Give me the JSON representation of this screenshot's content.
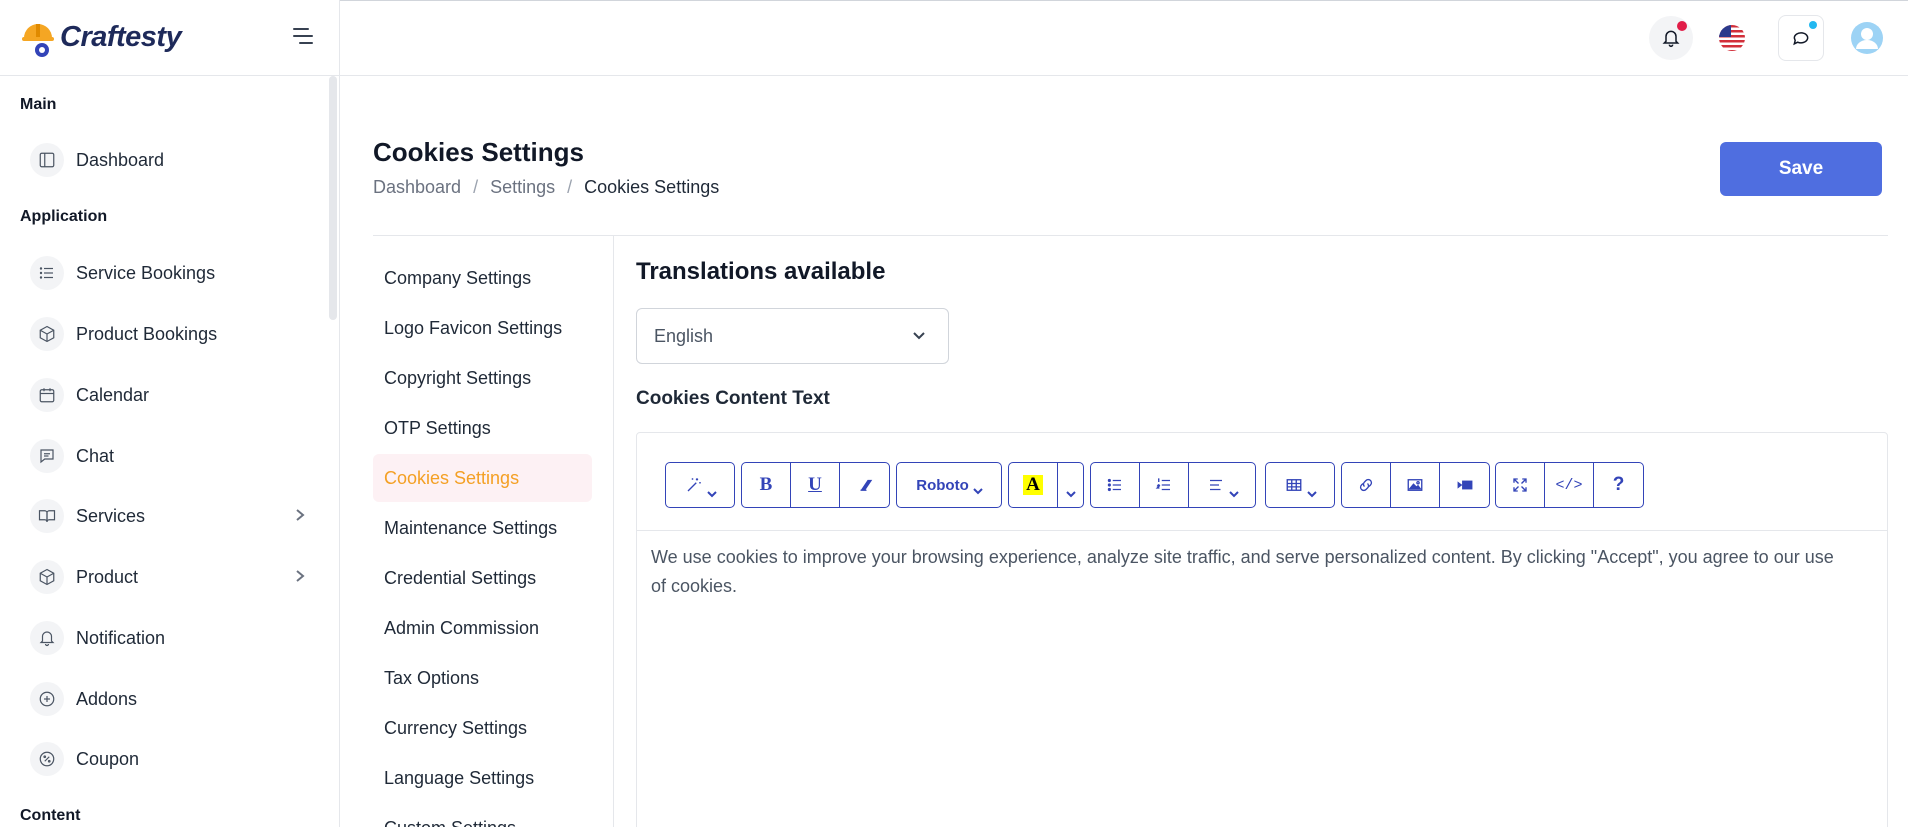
{
  "brand": {
    "name": "Craftesty"
  },
  "sidebar": {
    "sections": [
      {
        "label": "Main"
      },
      {
        "label": "Application"
      },
      {
        "label": "Content"
      }
    ],
    "items": [
      {
        "label": "Dashboard",
        "icon": "layout-icon"
      },
      {
        "label": "Service Bookings",
        "icon": "list-icon"
      },
      {
        "label": "Product Bookings",
        "icon": "box-icon"
      },
      {
        "label": "Calendar",
        "icon": "calendar-icon"
      },
      {
        "label": "Chat",
        "icon": "chat-icon"
      },
      {
        "label": "Services",
        "icon": "book-icon",
        "has_submenu": true
      },
      {
        "label": "Product",
        "icon": "box-icon",
        "has_submenu": true
      },
      {
        "label": "Notification",
        "icon": "bell-icon"
      },
      {
        "label": "Addons",
        "icon": "plus-circle-icon"
      },
      {
        "label": "Coupon",
        "icon": "percent-icon"
      }
    ]
  },
  "topbar": {
    "notification_dot_color": "#e11d48",
    "chat_dot_color": "#22b8f0",
    "language_flag": "us-flag-icon"
  },
  "page": {
    "title": "Cookies Settings",
    "breadcrumb": [
      "Dashboard",
      "Settings",
      "Cookies Settings"
    ],
    "save_label": "Save",
    "accent_color": "#4f6ee0"
  },
  "settings_menu": {
    "items": [
      "Company Settings",
      "Logo Favicon Settings",
      "Copyright Settings",
      "OTP Settings",
      "Cookies Settings",
      "Maintenance Settings",
      "Credential Settings",
      "Admin Commission",
      "Tax Options",
      "Currency Settings",
      "Language Settings",
      "Custom Settings"
    ],
    "active": "Cookies Settings",
    "active_color": "#f4a024"
  },
  "content": {
    "translations_title": "Translations available",
    "language_selected": "English",
    "field_label": "Cookies Content Text",
    "editor": {
      "font_name": "Roboto",
      "text": "We use cookies to improve your browsing experience, analyze site traffic, and serve personalized content. By clicking \"Accept\", you agree to our use of cookies."
    }
  }
}
